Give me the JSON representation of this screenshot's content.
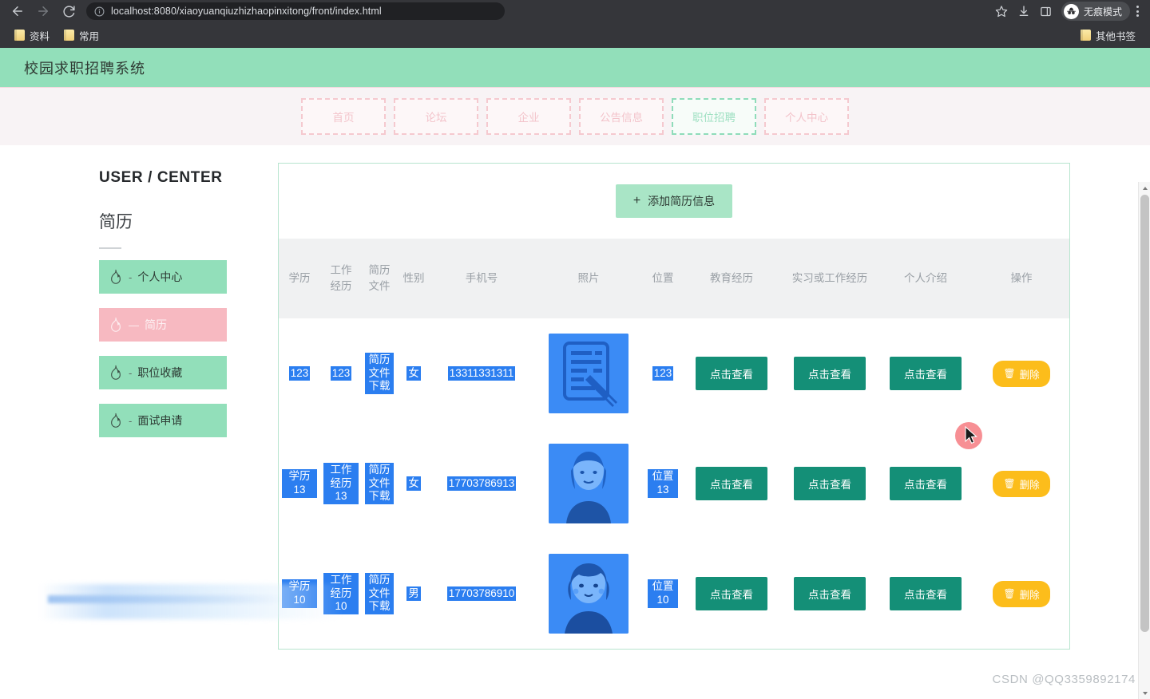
{
  "browser": {
    "back_icon": "back-arrow-icon",
    "forward_icon": "forward-arrow-icon",
    "reload_icon": "reload-icon",
    "url_host": "localhost:8080",
    "url_path": "/xiaoyuanqiuzhizhaopinxitong/front/index.html",
    "url_full": "localhost:8080/xiaoyuanqiuzhizhaopinxitong/front/index.html",
    "star_icon": "bookmark-star-icon",
    "download_icon": "download-icon",
    "sidepanel_icon": "side-panel-icon",
    "incognito_label": "无痕模式",
    "menu_icon": "kebab-menu-icon",
    "bookmarks": [
      {
        "label": "资料",
        "icon": "folder-icon"
      },
      {
        "label": "常用",
        "icon": "folder-icon"
      }
    ],
    "other_bookmarks": {
      "label": "其他书签",
      "icon": "folder-icon"
    }
  },
  "site": {
    "title": "校园求职招聘系统",
    "nav": [
      {
        "label": "首页",
        "active": false
      },
      {
        "label": "论坛",
        "active": false
      },
      {
        "label": "企业",
        "active": false
      },
      {
        "label": "公告信息",
        "active": false
      },
      {
        "label": "职位招聘",
        "active": true
      },
      {
        "label": "个人中心",
        "active": false
      }
    ]
  },
  "sidebar": {
    "title": "USER / CENTER",
    "subtitle": "简历",
    "items": [
      {
        "label": "个人中心",
        "icon": "flame-icon",
        "dash": "-",
        "active": false
      },
      {
        "label": "简历",
        "icon": "flame-icon",
        "dash": "—",
        "active": true
      },
      {
        "label": "职位收藏",
        "icon": "flame-icon",
        "dash": "-",
        "active": false
      },
      {
        "label": "面试申请",
        "icon": "flame-icon",
        "dash": "-",
        "active": false
      }
    ]
  },
  "main": {
    "add_button": {
      "label": "添加简历信息",
      "plus": "+"
    },
    "columns": [
      "学历",
      "工作经历",
      "简历文件",
      "性别",
      "手机号",
      "照片",
      "位置",
      "教育经历",
      "实习或工作经历",
      "个人介绍",
      "操作"
    ],
    "file_link_label": "简历文件下载",
    "view_label": "点击查看",
    "delete_label": "删除",
    "delete_icon": "trash-icon",
    "rows": [
      {
        "xueli": "123",
        "gongzuo": "123",
        "file": "简历文件下载",
        "xingbie": "女",
        "phone": "13311331311",
        "photo": "document-pen-image",
        "weizhi": "123",
        "jiaoyu": "点击查看",
        "shixi": "点击查看",
        "jieshao": "点击查看",
        "caozuo": "删除"
      },
      {
        "xueli": "学历13",
        "gongzuo": "工作经历13",
        "file": "简历文件下载",
        "xingbie": "女",
        "phone": "17703786913",
        "photo": "portrait-female-image",
        "weizhi": "位置13",
        "jiaoyu": "点击查看",
        "shixi": "点击查看",
        "jieshao": "点击查看",
        "caozuo": "删除"
      },
      {
        "xueli": "学历10",
        "gongzuo": "工作经历10",
        "file": "简历文件下载",
        "xingbie": "男",
        "phone": "17703786910",
        "photo": "portrait-child-image",
        "weizhi": "位置10",
        "jiaoyu": "点击查看",
        "shixi": "点击查看",
        "jieshao": "点击查看",
        "caozuo": "删除"
      }
    ]
  },
  "watermark": "CSDN @QQ3359892174",
  "colors": {
    "brand_green": "#92dfba",
    "accent_pink": "#f7b9c1",
    "view_button": "#148f77",
    "delete_button": "#fcbd1b",
    "selection_blue": "#2b7ef0",
    "chrome_dark": "#35363a"
  }
}
